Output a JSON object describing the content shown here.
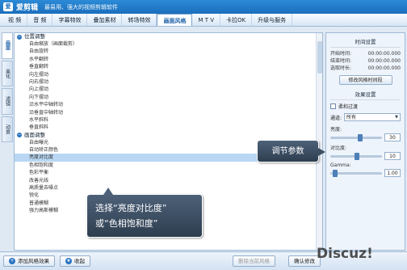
{
  "app": {
    "icon_text": "爱",
    "name": "爱剪辑",
    "slogan": "最易用、强大的视频剪辑软件"
  },
  "menu": [
    "视 频",
    "音 频",
    "字幕特效",
    "叠加素材",
    "转场特效",
    "画面风格",
    "M T V",
    "卡拉OK",
    "升级与服务"
  ],
  "menu_active_index": 5,
  "side_tabs": [
    "画面",
    "美化",
    "滤镜",
    "动景"
  ],
  "groups": [
    {
      "title": "位置调整",
      "items": [
        "自由缩放（画面裁剪）",
        "自由旋转",
        "水平翻转",
        "垂直翻转",
        "向左摆动",
        "向右摆动",
        "向上摆动",
        "向下摆动",
        "沿水平中轴转动",
        "沿垂直中轴转动",
        "水平斜料",
        "垂直斜料"
      ]
    },
    {
      "title": "画面调整",
      "items": [
        "自由曝光",
        "自动矫正颜色",
        "亮度对比度",
        "色相饱和度",
        "色彩平衡",
        "改善光线",
        "高质量去噪点",
        "锐化",
        "普通模糊",
        "强力高斯模糊"
      ]
    }
  ],
  "selected_item": "亮度对比度",
  "settings": {
    "time_title": "时间设置",
    "start_label": "开始时间:",
    "end_label": "结束时间:",
    "duration_label": "选取时长:",
    "start_value": "00:00:00.000",
    "end_value": "00:00:00.000",
    "duration_value": "00:00:00.000",
    "modify_button": "修改风格时间段",
    "effect_title": "效果设置",
    "soft_transition": "柔和过渡",
    "channel_label": "通道:",
    "channel_value": "所有",
    "brightness_label": "亮度:",
    "brightness_value": "30",
    "brightness_level": 0.58,
    "contrast_label": "对比度:",
    "contrast_value": "10",
    "contrast_level": 0.52,
    "gamma_label": "Gamma:",
    "gamma_value": "1.00",
    "gamma_level": 0.1
  },
  "bottom": {
    "add_style": "添加风格效果",
    "favorite": "收起",
    "delete_style": "删除当前风格",
    "confirm": "确认修改"
  },
  "callouts": {
    "adjust_params": "调节参数",
    "select_line1": "选择“亮度对比度”",
    "select_line2": "或“色相饱和度”"
  },
  "watermark": "Discuz!"
}
